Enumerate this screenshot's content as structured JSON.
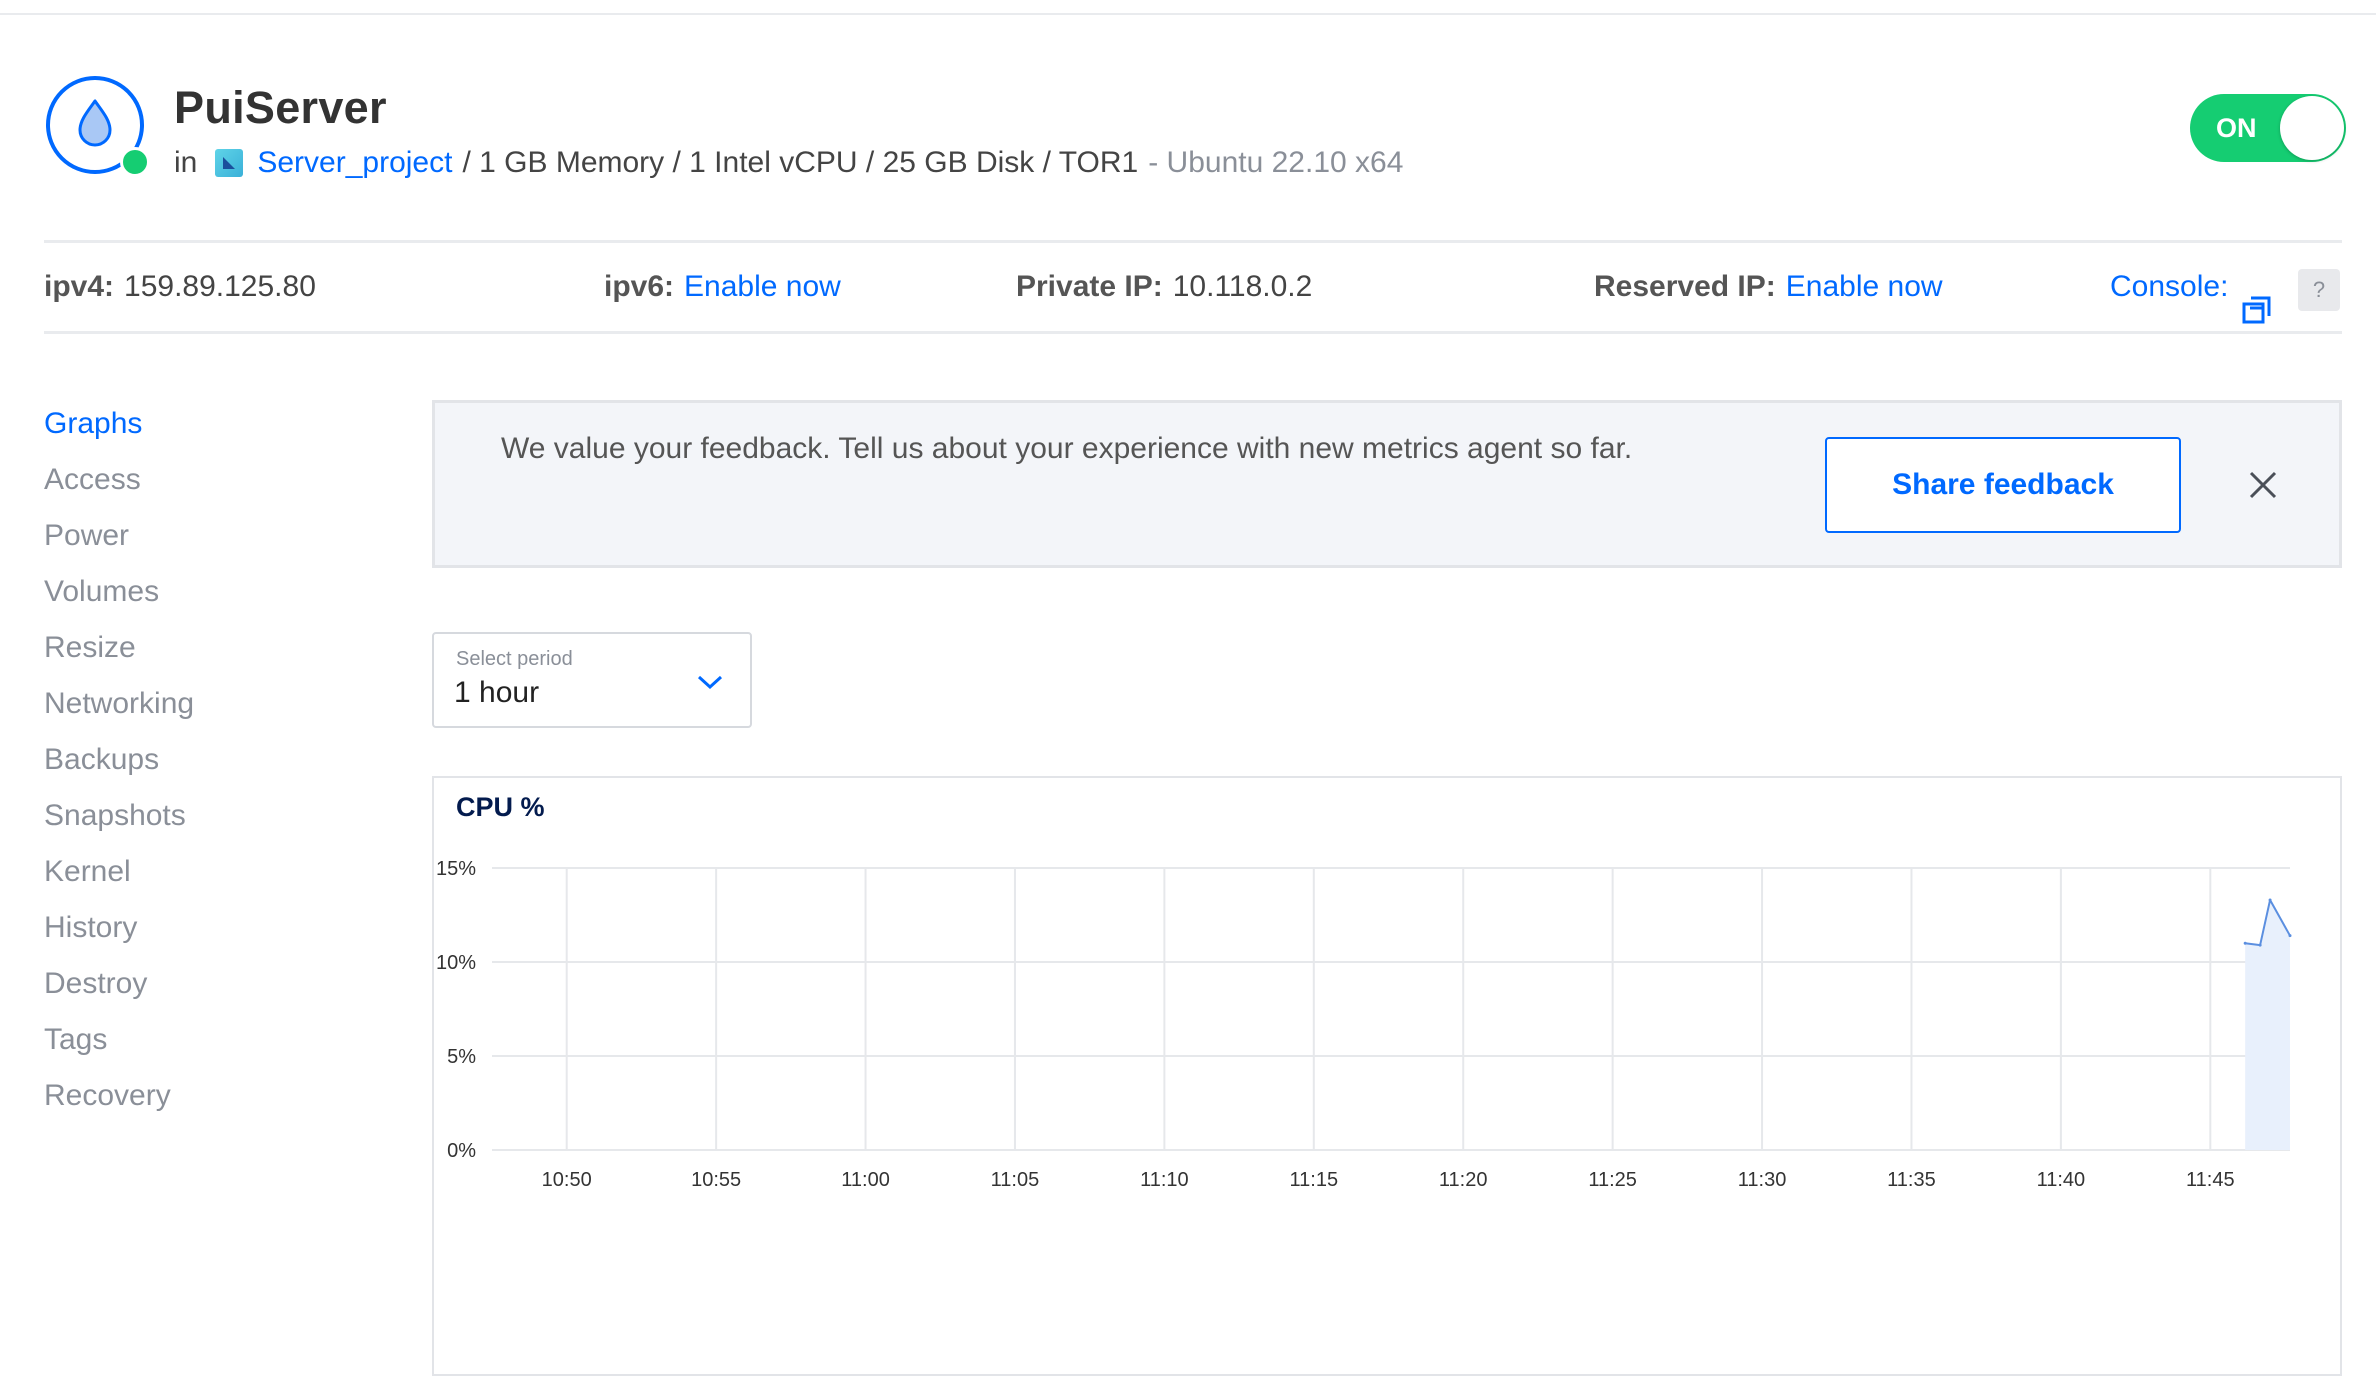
{
  "droplet": {
    "name": "PuiServer",
    "in_label": "in",
    "project": "Server_project",
    "specs": "/ 1 GB Memory / 1 Intel vCPU / 25 GB Disk / TOR1",
    "os": "- Ubuntu 22.10 x64",
    "power_state": "ON",
    "status_color": "#15cd72",
    "accent_color": "#0069ff"
  },
  "ip_bar": {
    "ipv4_label": "ipv4:",
    "ipv4_value": "159.89.125.80",
    "ipv6_label": "ipv6:",
    "ipv6_link": "Enable now",
    "private_ip_label": "Private IP:",
    "private_ip_value": "10.118.0.2",
    "reserved_ip_label": "Reserved IP:",
    "reserved_ip_link": "Enable now",
    "console_label": "Console:",
    "console_icon": "external-window-icon",
    "help_label": "?"
  },
  "sidebar": {
    "items": [
      {
        "label": "Graphs",
        "active": true
      },
      {
        "label": "Access",
        "active": false
      },
      {
        "label": "Power",
        "active": false
      },
      {
        "label": "Volumes",
        "active": false
      },
      {
        "label": "Resize",
        "active": false
      },
      {
        "label": "Networking",
        "active": false
      },
      {
        "label": "Backups",
        "active": false
      },
      {
        "label": "Snapshots",
        "active": false
      },
      {
        "label": "Kernel",
        "active": false
      },
      {
        "label": "History",
        "active": false
      },
      {
        "label": "Destroy",
        "active": false
      },
      {
        "label": "Tags",
        "active": false
      },
      {
        "label": "Recovery",
        "active": false
      }
    ]
  },
  "feedback": {
    "message": "We value your feedback. Tell us about your experience with new metrics agent so far.",
    "button_label": "Share feedback",
    "close_icon": "close-icon"
  },
  "period": {
    "label": "Select period",
    "value": "1 hour"
  },
  "chart_data": {
    "type": "area",
    "title": "CPU %",
    "xlabel": "",
    "ylabel": "",
    "x_ticks": [
      "10:50",
      "10:55",
      "11:00",
      "11:05",
      "11:10",
      "11:15",
      "11:20",
      "11:25",
      "11:30",
      "11:35",
      "11:40",
      "11:45"
    ],
    "y_ticks": [
      "0%",
      "5%",
      "10%",
      "15%"
    ],
    "ylim": [
      0,
      15
    ],
    "xlim": [
      "10:47:30",
      "11:47:40"
    ],
    "grid": true,
    "line_color": "#5b8fe0",
    "fill_color": "#e8f0fc",
    "series": [
      {
        "x": [
          "11:46:10",
          "11:46:40",
          "11:47:00",
          "11:47:40"
        ],
        "values": [
          11.0,
          10.9,
          13.3,
          11.4
        ]
      }
    ]
  }
}
